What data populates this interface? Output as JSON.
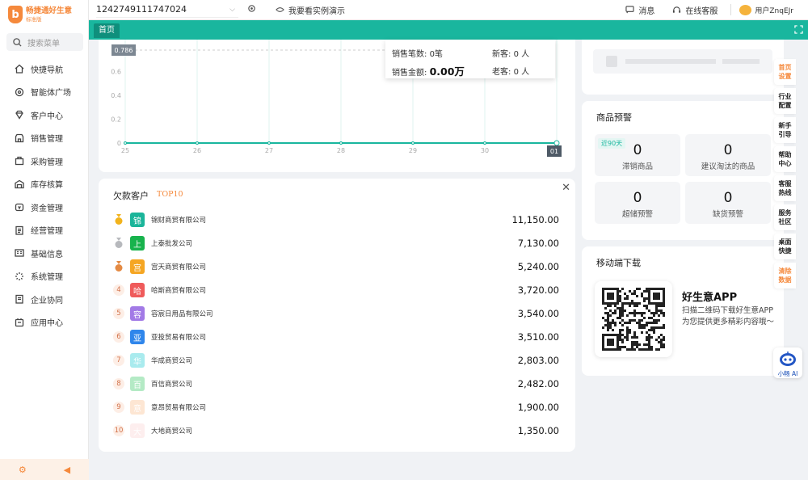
{
  "app": {
    "name": "畅捷通好生意",
    "edition": "标准版",
    "logo_glyph": "b"
  },
  "sidebar": {
    "search_placeholder": "搜索菜单",
    "items": [
      {
        "label": "快捷导航",
        "icon": "home-icon"
      },
      {
        "label": "智能体广场",
        "icon": "ai-icon"
      },
      {
        "label": "客户中心",
        "icon": "diamond-icon"
      },
      {
        "label": "销售管理",
        "icon": "shop-icon"
      },
      {
        "label": "采购管理",
        "icon": "bag-icon"
      },
      {
        "label": "库存核算",
        "icon": "warehouse-icon"
      },
      {
        "label": "资金管理",
        "icon": "money-icon"
      },
      {
        "label": "经营管理",
        "icon": "clipboard-icon"
      },
      {
        "label": "基础信息",
        "icon": "info-icon"
      },
      {
        "label": "系统管理",
        "icon": "loading-icon"
      },
      {
        "label": "企业协同",
        "icon": "document-icon"
      },
      {
        "label": "应用中心",
        "icon": "app-icon"
      }
    ]
  },
  "topbar": {
    "company_id": "1242749111747024",
    "demo_label": "我要看实例演示",
    "messages_label": "消息",
    "service_label": "在线客服",
    "user_label": "用户ZnqEJr"
  },
  "tabs": {
    "home": "首页"
  },
  "chart_data": {
    "type": "line",
    "categories": [
      "25",
      "26",
      "27",
      "28",
      "29",
      "30",
      "01"
    ],
    "y_ticks": [
      "0",
      "0.2",
      "0.4",
      "0.6"
    ],
    "ylim": [
      0,
      0.786
    ],
    "marker_value": "0.786",
    "series": [
      {
        "values": [
          0,
          0,
          0,
          0,
          0,
          0,
          0
        ]
      }
    ],
    "highlight_label": "01"
  },
  "tooltip": {
    "sales_count_label": "销售笔数:",
    "sales_count": "0笔",
    "new_customers_label": "新客:",
    "new_customers": "0 人",
    "sales_amount_label": "销售金额:",
    "sales_amount": "0.00万",
    "old_customers_label": "老客:",
    "old_customers": "0 人"
  },
  "debt": {
    "title": "欠款客户",
    "subtitle": "TOP10",
    "rows": [
      {
        "rank": "1",
        "avatar": "锦",
        "name": "锦财商贸有限公司",
        "amount": "11,150.00",
        "color": "#1bb59a"
      },
      {
        "rank": "2",
        "avatar": "上",
        "name": "上泰批发公司",
        "amount": "7,130.00",
        "color": "#18b34d"
      },
      {
        "rank": "3",
        "avatar": "宫",
        "name": "宫天商贸有限公司",
        "amount": "5,240.00",
        "color": "#f5a623"
      },
      {
        "rank": "4",
        "avatar": "哈",
        "name": "哈斯商贸有限公司",
        "amount": "3,720.00",
        "color": "#ef5b5b"
      },
      {
        "rank": "5",
        "avatar": "容",
        "name": "容宸日用品有限公司",
        "amount": "3,540.00",
        "color": "#a27ae6"
      },
      {
        "rank": "6",
        "avatar": "亚",
        "name": "亚投贸易有限公司",
        "amount": "3,510.00",
        "color": "#2f86eb"
      },
      {
        "rank": "7",
        "avatar": "华",
        "name": "华成商贸公司",
        "amount": "2,803.00",
        "color": "#a9ebee"
      },
      {
        "rank": "8",
        "avatar": "百",
        "name": "百信商贸公司",
        "amount": "2,482.00",
        "color": "#b4eac5"
      },
      {
        "rank": "9",
        "avatar": "意",
        "name": "意昂贸易有限公司",
        "amount": "1,900.00",
        "color": "#fde6d3"
      },
      {
        "rank": "10",
        "avatar": "大",
        "name": "大地商贸公司",
        "amount": "1,350.00",
        "color": "#fdeeee"
      }
    ]
  },
  "warn": {
    "title": "商品预警",
    "badge": "近90天",
    "boxes": [
      {
        "num": "0",
        "label": "滞销商品"
      },
      {
        "num": "0",
        "label": "建议淘汰的商品"
      },
      {
        "num": "0",
        "label": "超储预警"
      },
      {
        "num": "0",
        "label": "缺货预警"
      }
    ]
  },
  "mobile": {
    "title": "移动端下载",
    "app_name": "好生意APP",
    "desc": "扫描二维码下载好生意APP\n为您提供更多精彩内容哦～"
  },
  "dock": [
    {
      "label": "首页设置",
      "color": "#f5893c"
    },
    {
      "label": "行业配置",
      "color": "#222222"
    },
    {
      "label": "新手引导",
      "color": "#222222"
    },
    {
      "label": "帮助中心",
      "color": "#222222"
    },
    {
      "label": "客服热线",
      "color": "#222222"
    },
    {
      "label": "服务社区",
      "color": "#222222"
    },
    {
      "label": "桌面快捷",
      "color": "#222222"
    },
    {
      "label": "清除数据",
      "color": "#f5893c"
    }
  ],
  "assistant": {
    "label": "小畅 AI"
  },
  "colors": {
    "primary": "#19b69e",
    "accent": "#f5893c"
  }
}
